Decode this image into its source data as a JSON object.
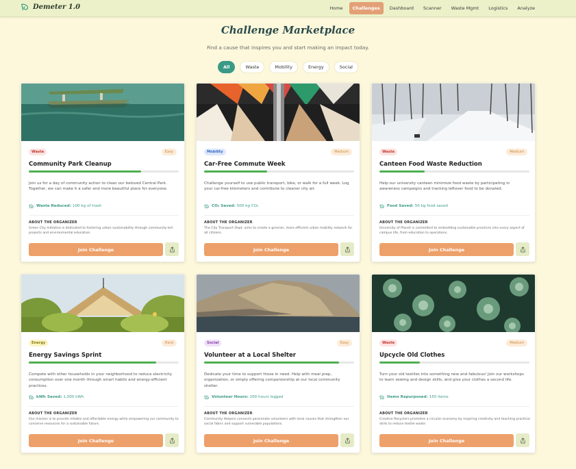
{
  "app": {
    "name": "Demeter 1.0"
  },
  "nav": {
    "links": [
      "Home",
      "Challenges",
      "Dashboard",
      "Scanner",
      "Waste Mgmt",
      "Logistics",
      "Analyze"
    ],
    "active": "Challenges"
  },
  "header": {
    "title": "Challenge Marketplace",
    "subtitle": "Find a cause that inspires you and start making an impact today."
  },
  "filters": {
    "items": [
      "All",
      "Waste",
      "Mobility",
      "Energy",
      "Social"
    ],
    "active": "All"
  },
  "labels": {
    "organizer_heading": "ABOUT THE ORGANIZER",
    "join": "Join Challenge"
  },
  "colors": {
    "accent": "#3a9a86",
    "join": "#eda06a",
    "nav_active": "#e3a076",
    "progress": "#4caf50",
    "background": "#fdf8dc"
  },
  "cards": [
    {
      "category": "Waste",
      "difficulty": "Easy",
      "title": "Community Park Cleanup",
      "progress": 0.75,
      "image": "canoe-lake",
      "description": "Join us for a day of community action to clean our beloved Central Park. Together, we can make it a safer and more beautiful place for everyone.",
      "impact_label": "Waste Reduced:",
      "impact_value": "100 kg of trash",
      "organizer": "Green City Initiative is dedicated to fostering urban sustainability through community-led projects and environmental education."
    },
    {
      "category": "Mobility",
      "difficulty": "Medium",
      "title": "Car-Free Commute Week",
      "progress": 0.42,
      "image": "clothes-rack",
      "description": "Challenge yourself to use public transport, bike, or walk for a full week. Log your car-free kilometers and contribute to cleaner city air.",
      "impact_label": "CO₂ Saved:",
      "impact_value": "500 kg CO₂",
      "organizer": "The City Transport Dept. aims to create a greener, more efficient urban mobility network for all citizens."
    },
    {
      "category": "Waste",
      "difficulty": "Medium",
      "title": "Canteen Food Waste Reduction",
      "progress": 0.3,
      "image": "snowy-path",
      "description": "Help our university canteen minimize food waste by participating in awareness campaigns and tracking leftover food to be donated.",
      "impact_label": "Food Saved:",
      "impact_value": "50 kg food saved",
      "organizer": "University of Planet is committed to embedding sustainable practices into every aspect of campus life, from education to operations."
    },
    {
      "category": "Energy",
      "difficulty": "Hard",
      "title": "Energy Savings Sprint",
      "progress": 0.85,
      "image": "glass-house",
      "description": "Compete with other households in your neighborhood to reduce electricity consumption over one month through smart habits and energy-efficient practices.",
      "impact_label": "kWh Saved:",
      "impact_value": "1,000 kWh",
      "organizer": "Our mission is to provide reliable and affordable energy while empowering our community to conserve resources for a sustainable future."
    },
    {
      "category": "Social",
      "difficulty": "Easy",
      "title": "Volunteer at a Local Shelter",
      "progress": 0.9,
      "image": "sea-cliff",
      "description": "Dedicate your time to support those in need. Help with meal prep, organization, or simply offering companionship at our local community shelter.",
      "impact_label": "Volunteer Hours:",
      "impact_value": "200 hours logged",
      "organizer": "Community Helpers connects passionate volunteers with local causes that strengthen our social fabric and support vulnerable populations."
    },
    {
      "category": "Waste",
      "difficulty": "Medium",
      "title": "Upcycle Old Clothes",
      "progress": 0.27,
      "image": "succulents",
      "description": "Turn your old textiles into something new and fabulous! Join our workshops to learn sewing and design skills, and give your clothes a second life.",
      "impact_label": "Items Repurposed:",
      "impact_value": "150 items",
      "organizer": "Creative Recyclers promotes a circular economy by inspiring creativity and teaching practical skills to reduce textile waste."
    }
  ]
}
